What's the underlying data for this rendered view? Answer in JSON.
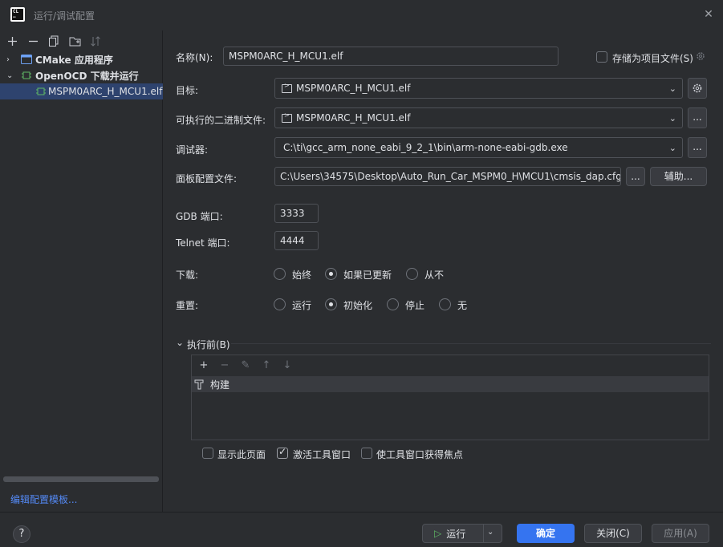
{
  "window": {
    "title": "运行/调试配置"
  },
  "sidebar": {
    "groups": [
      {
        "label": "CMake 应用程序"
      },
      {
        "label": "OpenOCD 下载并运行"
      }
    ],
    "selected_item": "MSPM0ARC_H_MCU1.elf",
    "edit_templates": "编辑配置模板..."
  },
  "form": {
    "name_label": "名称(N):",
    "name_value": "MSPM0ARC_H_MCU1.elf",
    "store_label": "存储为项目文件(S)",
    "target_label": "目标:",
    "target_value": "MSPM0ARC_H_MCU1.elf",
    "exe_label": "可执行的二进制文件:",
    "exe_value": "MSPM0ARC_H_MCU1.elf",
    "debugger_label": "调试器:",
    "debugger_value": "C:\\ti\\gcc_arm_none_eabi_9_2_1\\bin\\arm-none-eabi-gdb.exe",
    "board_label": "面板配置文件:",
    "board_value": "C:\\Users\\34575\\Desktop\\Auto_Run_Car_MSPM0_H\\MCU1\\cmsis_dap.cfg",
    "ellipsis": "...",
    "assist": "辅助...",
    "gdb_port_label": "GDB 端口:",
    "gdb_port_value": "3333",
    "telnet_port_label": "Telnet 端口:",
    "telnet_port_value": "4444",
    "download_label": "下载:",
    "download_options": [
      "始终",
      "如果已更新",
      "从不"
    ],
    "reset_label": "重置:",
    "reset_options": [
      "运行",
      "初始化",
      "停止",
      "无"
    ],
    "before_label": "执行前(B)",
    "build_item": "构建",
    "show_page": "显示此页面",
    "activate_tool": "激活工具窗口",
    "focus_tool": "使工具窗口获得焦点"
  },
  "footer": {
    "help": "?",
    "run": "运行",
    "ok": "确定",
    "close": "关闭(C)",
    "apply": "应用(A)"
  }
}
